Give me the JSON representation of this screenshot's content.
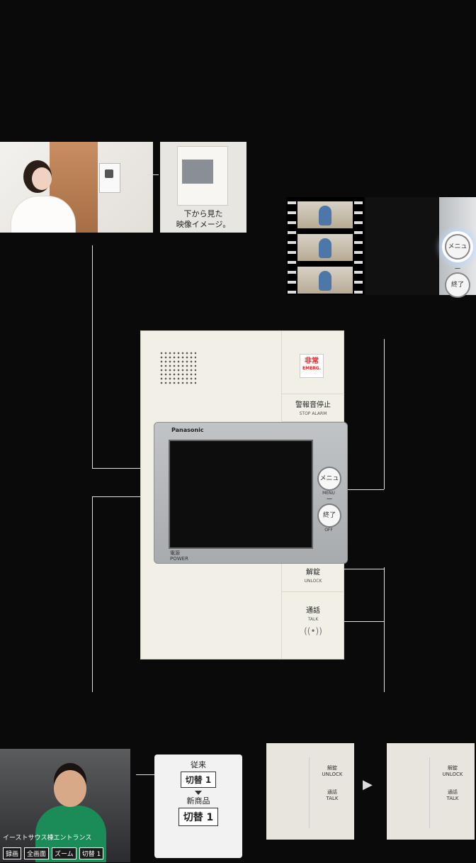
{
  "headline": "",
  "subhead": "",
  "lead": "",
  "photo_caption": "下から見た\n映像イメージ。",
  "right_heading": "",
  "right_caption": "",
  "device": {
    "emerg_jp": "非常",
    "emerg_en": "EMERG.",
    "stop_alarm_jp": "警報音停止",
    "stop_alarm_en": "STOP ALARM",
    "brand": "Panasonic",
    "menu_btn": "メニュー",
    "menu_en": "MENU",
    "end_btn": "終了",
    "off_en": "OFF",
    "power_jp": "電源",
    "power_en": "POWER",
    "unlock_jp": "解錠",
    "unlock_en": "UNLOCK",
    "talk_jp": "通話",
    "talk_en": "TALK"
  },
  "film_screen_buttons": {
    "menu": "メニュー",
    "end": "終了"
  },
  "left_footer_heading": "",
  "right_footer_heading": "",
  "lobby": {
    "tag": "イーストサウス棟エントランス",
    "buttons": [
      "録画",
      "全画面",
      "ズーム",
      "切替 1"
    ]
  },
  "compare": {
    "old_label": "従来",
    "old_button": "切替 1",
    "new_label": "新商品",
    "new_button": "切替 1"
  },
  "hand_photo": {
    "unlock_jp": "解錠",
    "unlock_en": "UNLOCK",
    "talk_jp": "通話",
    "talk_en": "TALK"
  },
  "right_footer_caption": ""
}
